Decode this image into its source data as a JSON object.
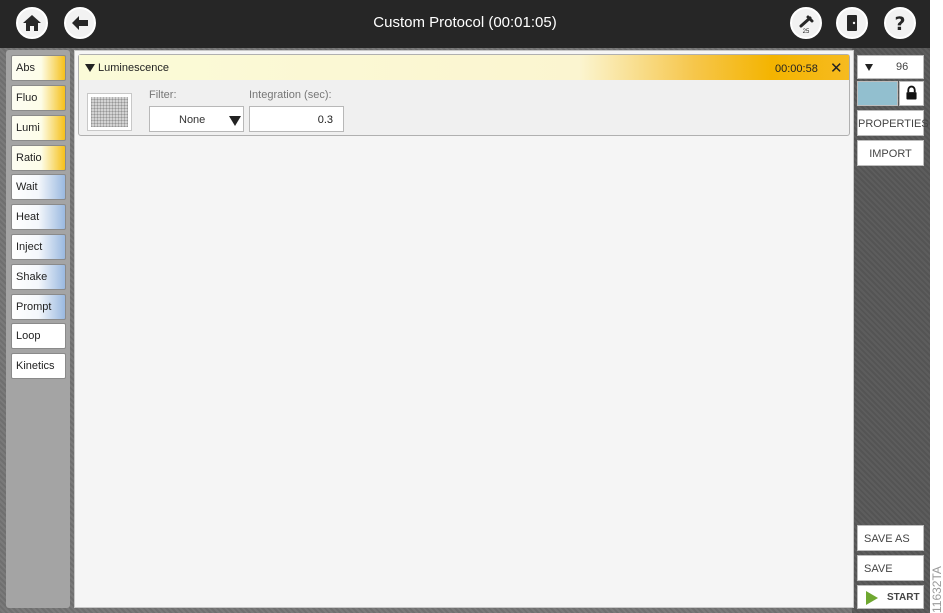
{
  "window": {
    "title": "Custom Protocol (00:01:05)"
  },
  "icons": {
    "home": "home-icon",
    "back": "back-arrow-icon",
    "tools": "wrench-icon",
    "tools_badge": "25",
    "exit": "door-icon",
    "help": "help-icon"
  },
  "tools": [
    {
      "label": "Abs",
      "style": "yellow"
    },
    {
      "label": "Fluo",
      "style": "yellow"
    },
    {
      "label": "Lumi",
      "style": "yellow"
    },
    {
      "label": "Ratio",
      "style": "yellow"
    },
    {
      "label": "Wait",
      "style": "blue"
    },
    {
      "label": "Heat",
      "style": "blue"
    },
    {
      "label": "Inject",
      "style": "blue"
    },
    {
      "label": "Shake",
      "style": "blue"
    },
    {
      "label": "Prompt",
      "style": "blue"
    },
    {
      "label": "Loop",
      "style": "white"
    },
    {
      "label": "Kinetics",
      "style": "white"
    }
  ],
  "step": {
    "name": "Luminescence",
    "time": "00:00:58",
    "close_glyph": "✕",
    "filter_label": "Filter:",
    "filter_value": "None",
    "integration_label": "Integration (sec):",
    "integration_value": "0.3"
  },
  "right_panel": {
    "plate_value": "96",
    "properties_label": "PROPERTIES",
    "import_label": "IMPORT",
    "save_as_label": "SAVE AS",
    "save_label": "SAVE",
    "start_label": "START"
  },
  "figure_id": "11632TA",
  "colors": {
    "titlebar": "#262626",
    "accent_yellow": "#f4b400",
    "accent_blue": "#9ab9e0",
    "plate_swatch": "#92bfcf",
    "start_green": "#6fa830"
  }
}
